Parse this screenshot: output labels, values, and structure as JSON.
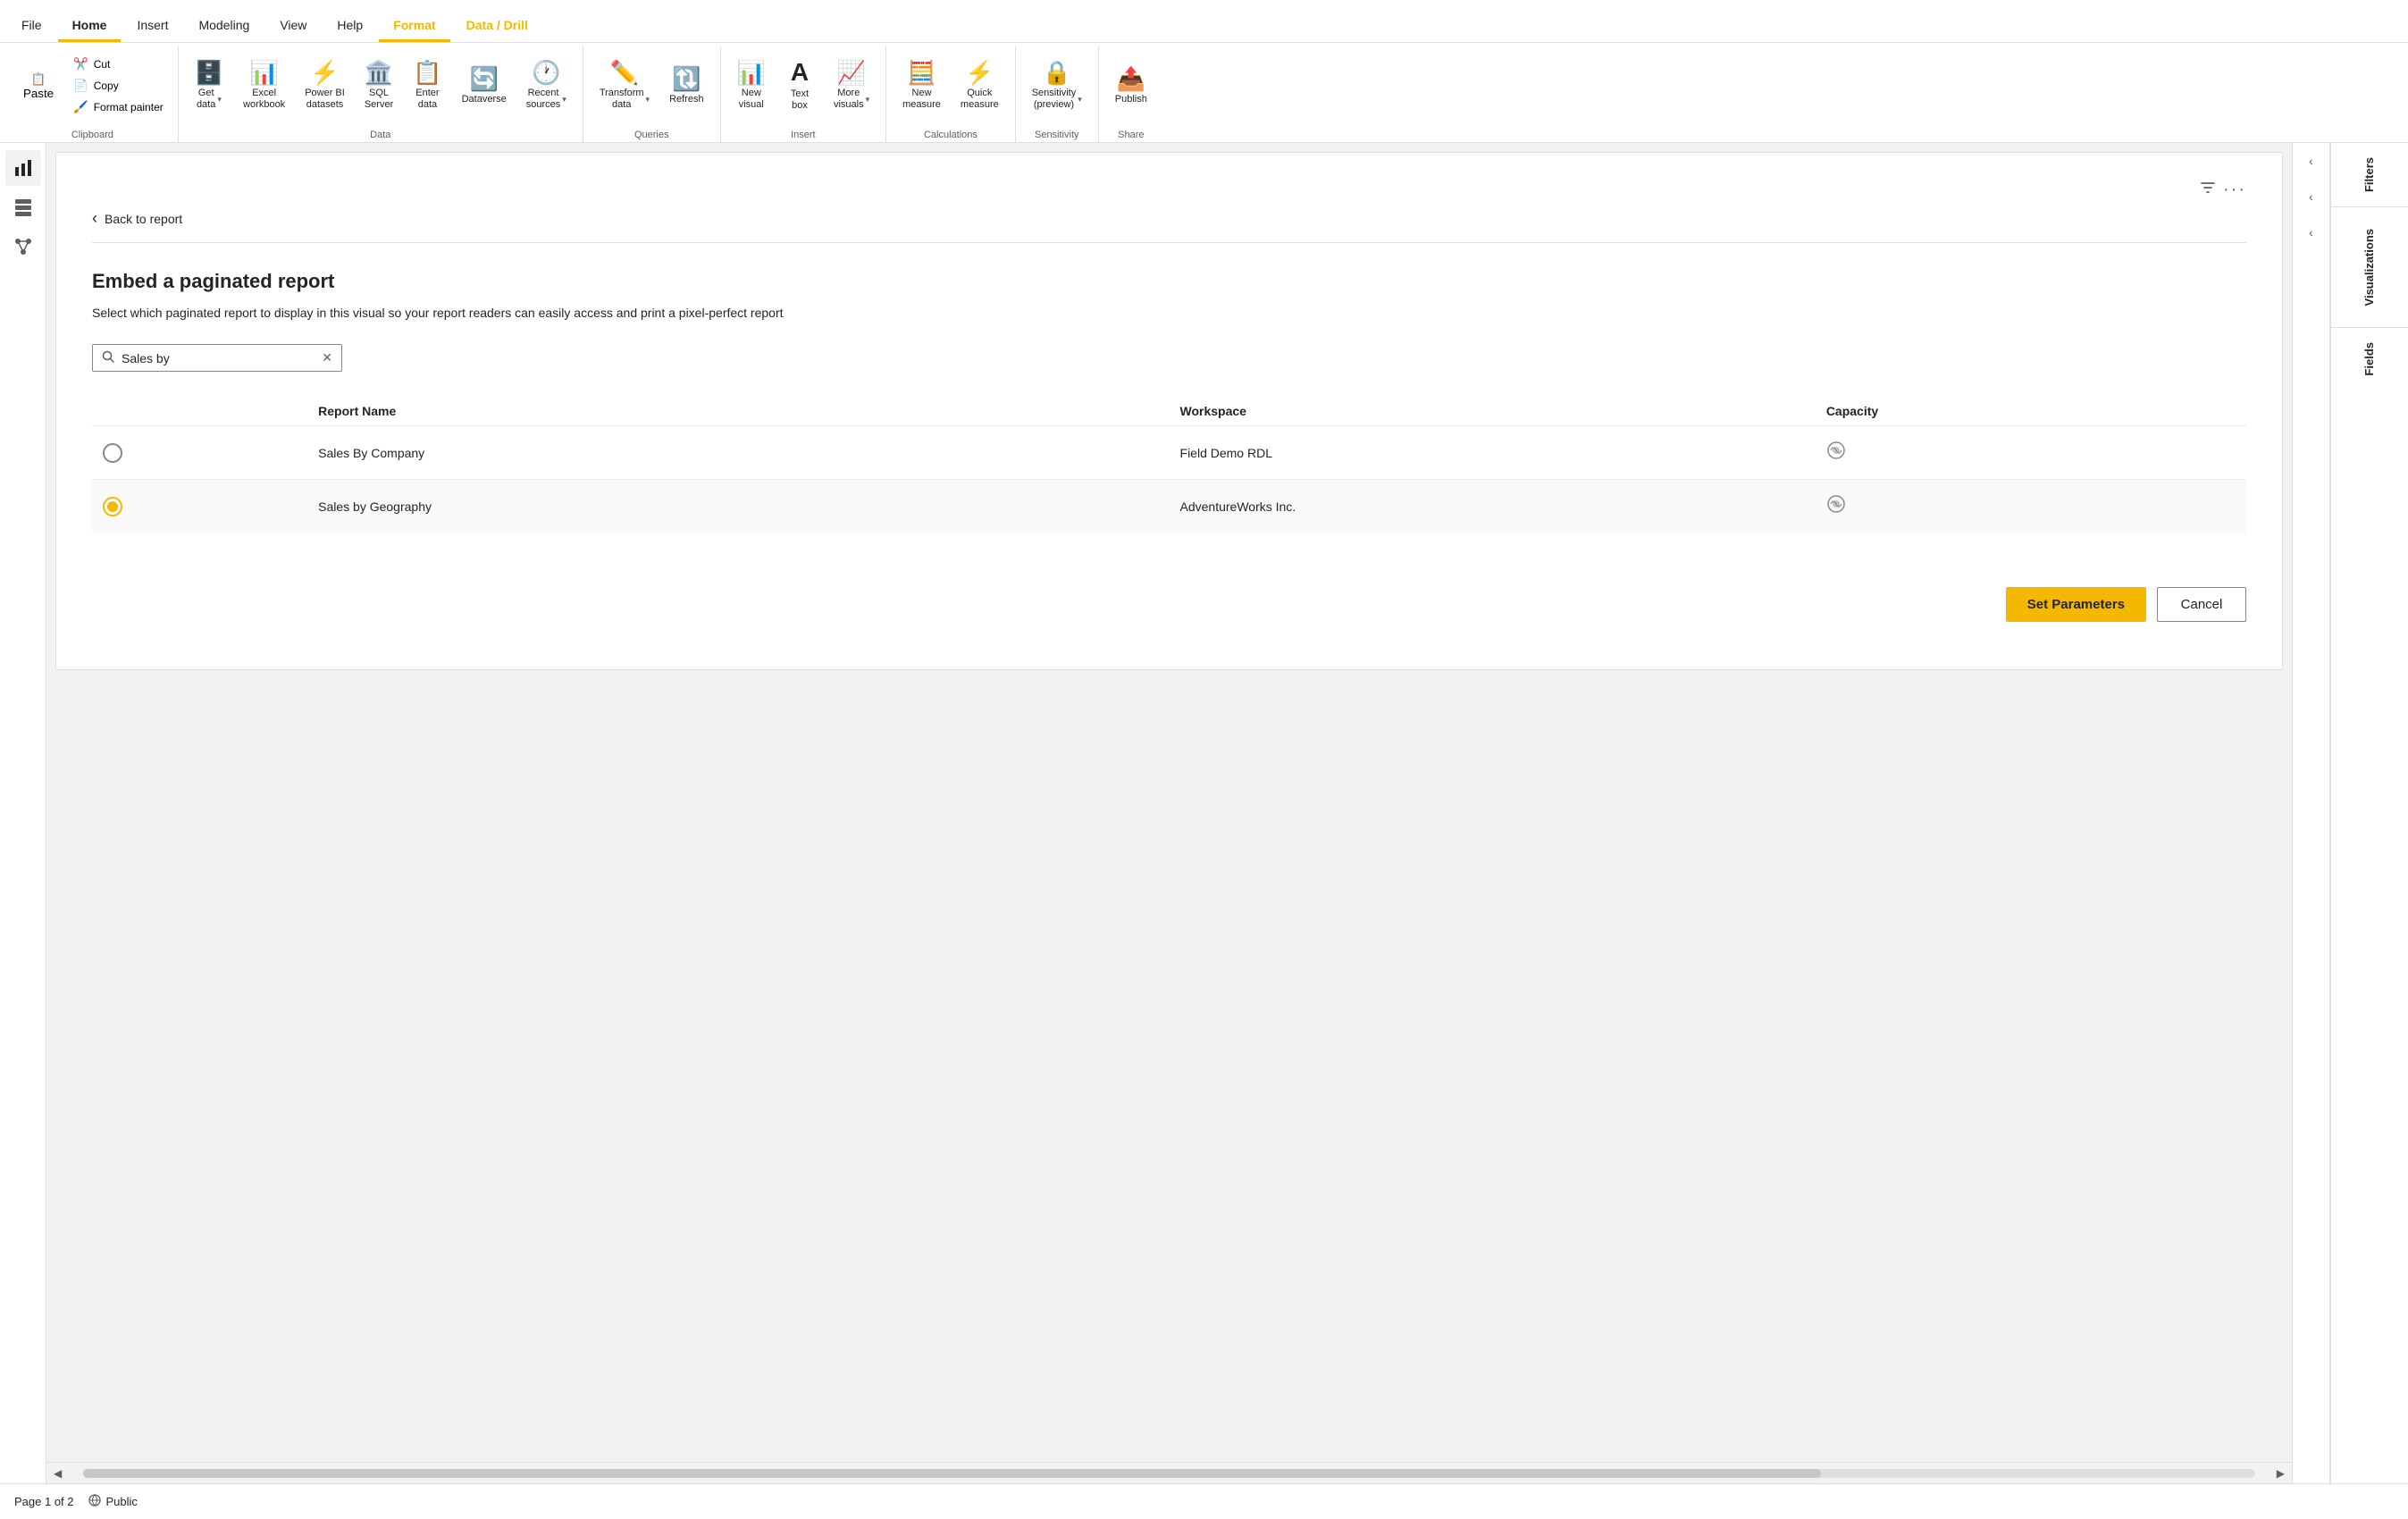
{
  "tabs": [
    {
      "id": "file",
      "label": "File",
      "active": false
    },
    {
      "id": "home",
      "label": "Home",
      "active": true
    },
    {
      "id": "insert",
      "label": "Insert",
      "active": false
    },
    {
      "id": "modeling",
      "label": "Modeling",
      "active": false
    },
    {
      "id": "view",
      "label": "View",
      "active": false
    },
    {
      "id": "help",
      "label": "Help",
      "active": false
    },
    {
      "id": "format",
      "label": "Format",
      "active": false,
      "highlighted": true
    },
    {
      "id": "datadrill",
      "label": "Data / Drill",
      "active": false,
      "highlighted": true
    }
  ],
  "ribbon": {
    "clipboard": {
      "label": "Clipboard",
      "paste": "Paste",
      "cut": "Cut",
      "copy": "Copy",
      "format_painter": "Format painter"
    },
    "data": {
      "label": "Data",
      "get_data": "Get\ndata",
      "excel_workbook": "Excel\nworkbook",
      "power_bi_datasets": "Power BI\ndatasets",
      "sql_server": "SQL\nServer",
      "enter_data": "Enter\ndata",
      "dataverse": "Dataverse",
      "recent_sources": "Recent\nsources"
    },
    "queries": {
      "label": "Queries",
      "transform_data": "Transform\ndata",
      "refresh": "Refresh"
    },
    "insert": {
      "label": "Insert",
      "new_visual": "New\nvisual",
      "text_box": "Text\nbox",
      "more_visuals": "More\nvisuals"
    },
    "calculations": {
      "label": "Calculations",
      "new_measure": "New\nmeasure",
      "quick_measure": "Quick\nmeasure"
    },
    "sensitivity": {
      "label": "Sensitivity",
      "sensitivity": "Sensitivity\n(preview)"
    },
    "share": {
      "label": "Share",
      "publish": "Publish"
    }
  },
  "dialog": {
    "back_label": "Back to report",
    "title": "Embed a paginated report",
    "description": "Select which paginated report to display in this visual so your report readers can easily access and print a pixel-perfect report",
    "search_placeholder": "Sales by",
    "search_value": "Sales by",
    "table": {
      "headers": [
        "",
        "Report Name",
        "Workspace",
        "Capacity"
      ],
      "rows": [
        {
          "id": 1,
          "selected": false,
          "report_name": "Sales By Company",
          "workspace": "Field Demo RDL",
          "capacity": "premium"
        },
        {
          "id": 2,
          "selected": true,
          "report_name": "Sales by Geography",
          "workspace": "AdventureWorks Inc.",
          "capacity": "premium"
        }
      ]
    },
    "set_parameters_btn": "Set Parameters",
    "cancel_btn": "Cancel"
  },
  "right_panels": {
    "filters_label": "Filters",
    "visualizations_label": "Visualizations",
    "fields_label": "Fields"
  },
  "status_bar": {
    "page": "Page 1 of 2",
    "public": "Public"
  }
}
